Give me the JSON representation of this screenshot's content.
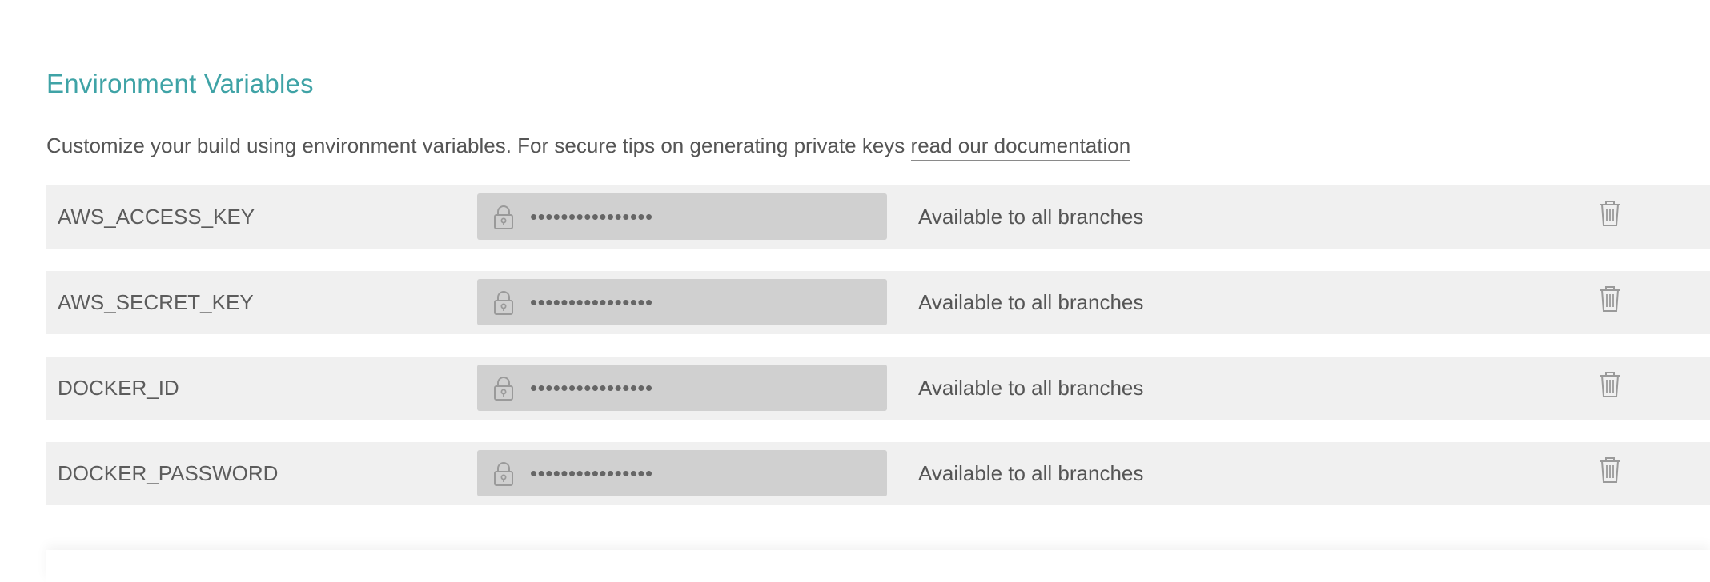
{
  "section": {
    "title": "Environment Variables",
    "description": "Customize your build using environment variables. For secure tips on generating private keys ",
    "doc_link_label": "read our documentation"
  },
  "env_vars": [
    {
      "name": "AWS_ACCESS_KEY",
      "value_mask": "••••••••••••••••",
      "branch": "Available to all branches",
      "icon": "lock-icon",
      "action_icon": "trash-icon"
    },
    {
      "name": "AWS_SECRET_KEY",
      "value_mask": "••••••••••••••••",
      "branch": "Available to all branches",
      "icon": "lock-icon",
      "action_icon": "trash-icon"
    },
    {
      "name": "DOCKER_ID",
      "value_mask": "••••••••••••••••",
      "branch": "Available to all branches",
      "icon": "lock-icon",
      "action_icon": "trash-icon"
    },
    {
      "name": "DOCKER_PASSWORD",
      "value_mask": "••••••••••••••••",
      "branch": "Available to all branches",
      "icon": "lock-icon",
      "action_icon": "trash-icon"
    }
  ],
  "colors": {
    "title": "#3fa3a6",
    "row_background": "#f0f0f0",
    "value_background": "#d0d0d0",
    "text": "#555555",
    "icon": "#9a9a9a"
  }
}
